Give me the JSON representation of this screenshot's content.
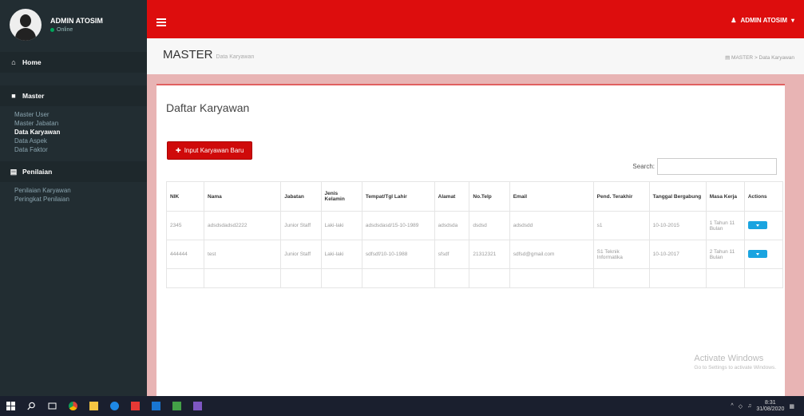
{
  "user": {
    "name": "ADMIN ATOSIM",
    "status": "Online"
  },
  "nav": {
    "home": "Home",
    "master": {
      "label": "Master",
      "items": [
        "Master User",
        "Master Jabatan",
        "Data Karyawan",
        "Data Aspek",
        "Data Faktor"
      ]
    },
    "penilaian": {
      "label": "Penilaian",
      "items": [
        "Penilaian Karyawan",
        "Peringkat Penilaian"
      ]
    }
  },
  "header": {
    "admin_label": "ADMIN ATOSIM"
  },
  "page": {
    "title": "MASTER",
    "subtitle": "Data Karyawan",
    "breadcrumb": [
      "MASTER",
      "Data Karyawan"
    ]
  },
  "box": {
    "title": "Daftar Karyawan",
    "add_button": "Input Karyawan Baru",
    "search_label": "Search:",
    "search_value": ""
  },
  "table": {
    "headers": [
      "NIK",
      "Nama",
      "Jabatan",
      "Jenis Kelamin",
      "Tempat/Tgl Lahir",
      "Alamat",
      "No.Telp",
      "Email",
      "Pend. Terakhir",
      "Tanggal Bergabung",
      "Masa Kerja",
      "Actions"
    ],
    "rows": [
      [
        "2345",
        "adsdsdadsd2222",
        "Junior Staff",
        "Laki-laki",
        "adsdsdasd/15-10-1989",
        "adsdsda",
        "dsdsd",
        "adsdsdd",
        "s1",
        "10-10-2015",
        "1 Tahun 11 Bulan"
      ],
      [
        "444444",
        "test",
        "Junior Staff",
        "Laki-laki",
        "sdfsdf/10-10-1988",
        "sfsdf",
        "21312321",
        "sdfsd@gmail.com",
        "S1 Teknik Informatika",
        "10-10-2017",
        "2 Tahun 11 Bulan"
      ]
    ]
  },
  "watermark": {
    "title": "Activate Windows",
    "subtitle": "Go to Settings to activate Windows."
  },
  "taskbar": {
    "time": "8:31",
    "date": "31/08/2020"
  },
  "colors": {
    "header": "#dd0d0d",
    "sidebar": "#222d32",
    "action_button": "#1aa4e0"
  }
}
